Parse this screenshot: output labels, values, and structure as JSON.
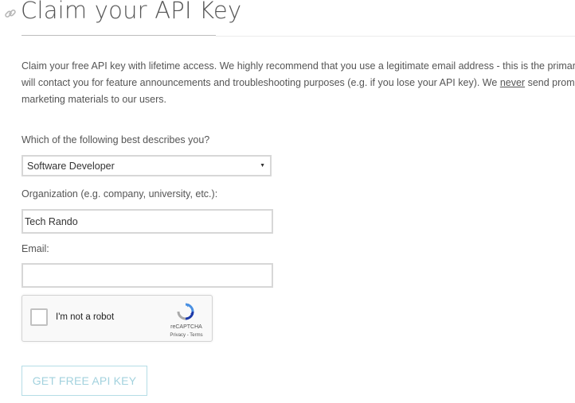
{
  "page": {
    "title": "Claim your API Key",
    "link_icon": "link-icon"
  },
  "intro": {
    "line1": "Claim your free API key with lifetime access. We highly recommend that you use a legitimate email address - this is the primary",
    "line2_before": "will contact you for feature announcements and troubleshooting purposes (e.g. if you lose your API key). We ",
    "line2_emphasis": "never",
    "line2_after": " send promot",
    "line3": "marketing materials to our users."
  },
  "form": {
    "role": {
      "label": "Which of the following best describes you?",
      "selected": "Software Developer",
      "caret": "▼"
    },
    "organization": {
      "label": "Organization (e.g. company, university, etc.):",
      "value": "Tech Rando"
    },
    "email": {
      "label": "Email:",
      "value": ""
    },
    "captcha": {
      "label": "I'm not a robot",
      "brand": "reCAPTCHA",
      "links": "Privacy - Terms",
      "icon": "recaptcha-logo-icon"
    },
    "submit_label": "GET FREE API KEY"
  },
  "colors": {
    "button_border": "#b5dde6",
    "button_text": "#a3d2de",
    "input_border": "#d7d7d7"
  }
}
